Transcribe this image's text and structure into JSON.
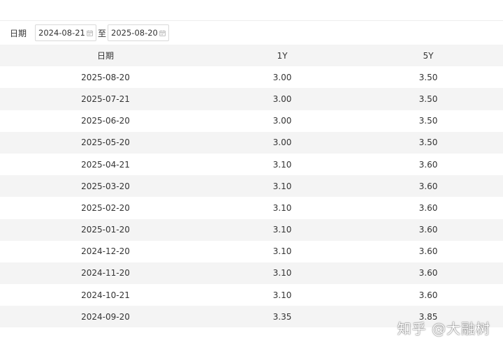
{
  "filter": {
    "label": "日期",
    "start_date": "2024-08-21",
    "separator": "至",
    "end_date": "2025-08-20"
  },
  "table": {
    "headers": [
      "日期",
      "1Y",
      "5Y"
    ],
    "rows": [
      {
        "date": "2025-08-20",
        "y1": "3.00",
        "y5": "3.50"
      },
      {
        "date": "2025-07-21",
        "y1": "3.00",
        "y5": "3.50"
      },
      {
        "date": "2025-06-20",
        "y1": "3.00",
        "y5": "3.50"
      },
      {
        "date": "2025-05-20",
        "y1": "3.00",
        "y5": "3.50"
      },
      {
        "date": "2025-04-21",
        "y1": "3.10",
        "y5": "3.60"
      },
      {
        "date": "2025-03-20",
        "y1": "3.10",
        "y5": "3.60"
      },
      {
        "date": "2025-02-20",
        "y1": "3.10",
        "y5": "3.60"
      },
      {
        "date": "2025-01-20",
        "y1": "3.10",
        "y5": "3.60"
      },
      {
        "date": "2024-12-20",
        "y1": "3.10",
        "y5": "3.60"
      },
      {
        "date": "2024-11-20",
        "y1": "3.10",
        "y5": "3.60"
      },
      {
        "date": "2024-10-21",
        "y1": "3.10",
        "y5": "3.60"
      },
      {
        "date": "2024-09-20",
        "y1": "3.35",
        "y5": "3.85"
      }
    ]
  },
  "watermark": "知乎 @大融树",
  "icons": {
    "date_picker": "calendar-icon"
  },
  "colors": {
    "stripe": "#f4f4f4",
    "border": "#d9d9d9",
    "text": "#333333"
  }
}
